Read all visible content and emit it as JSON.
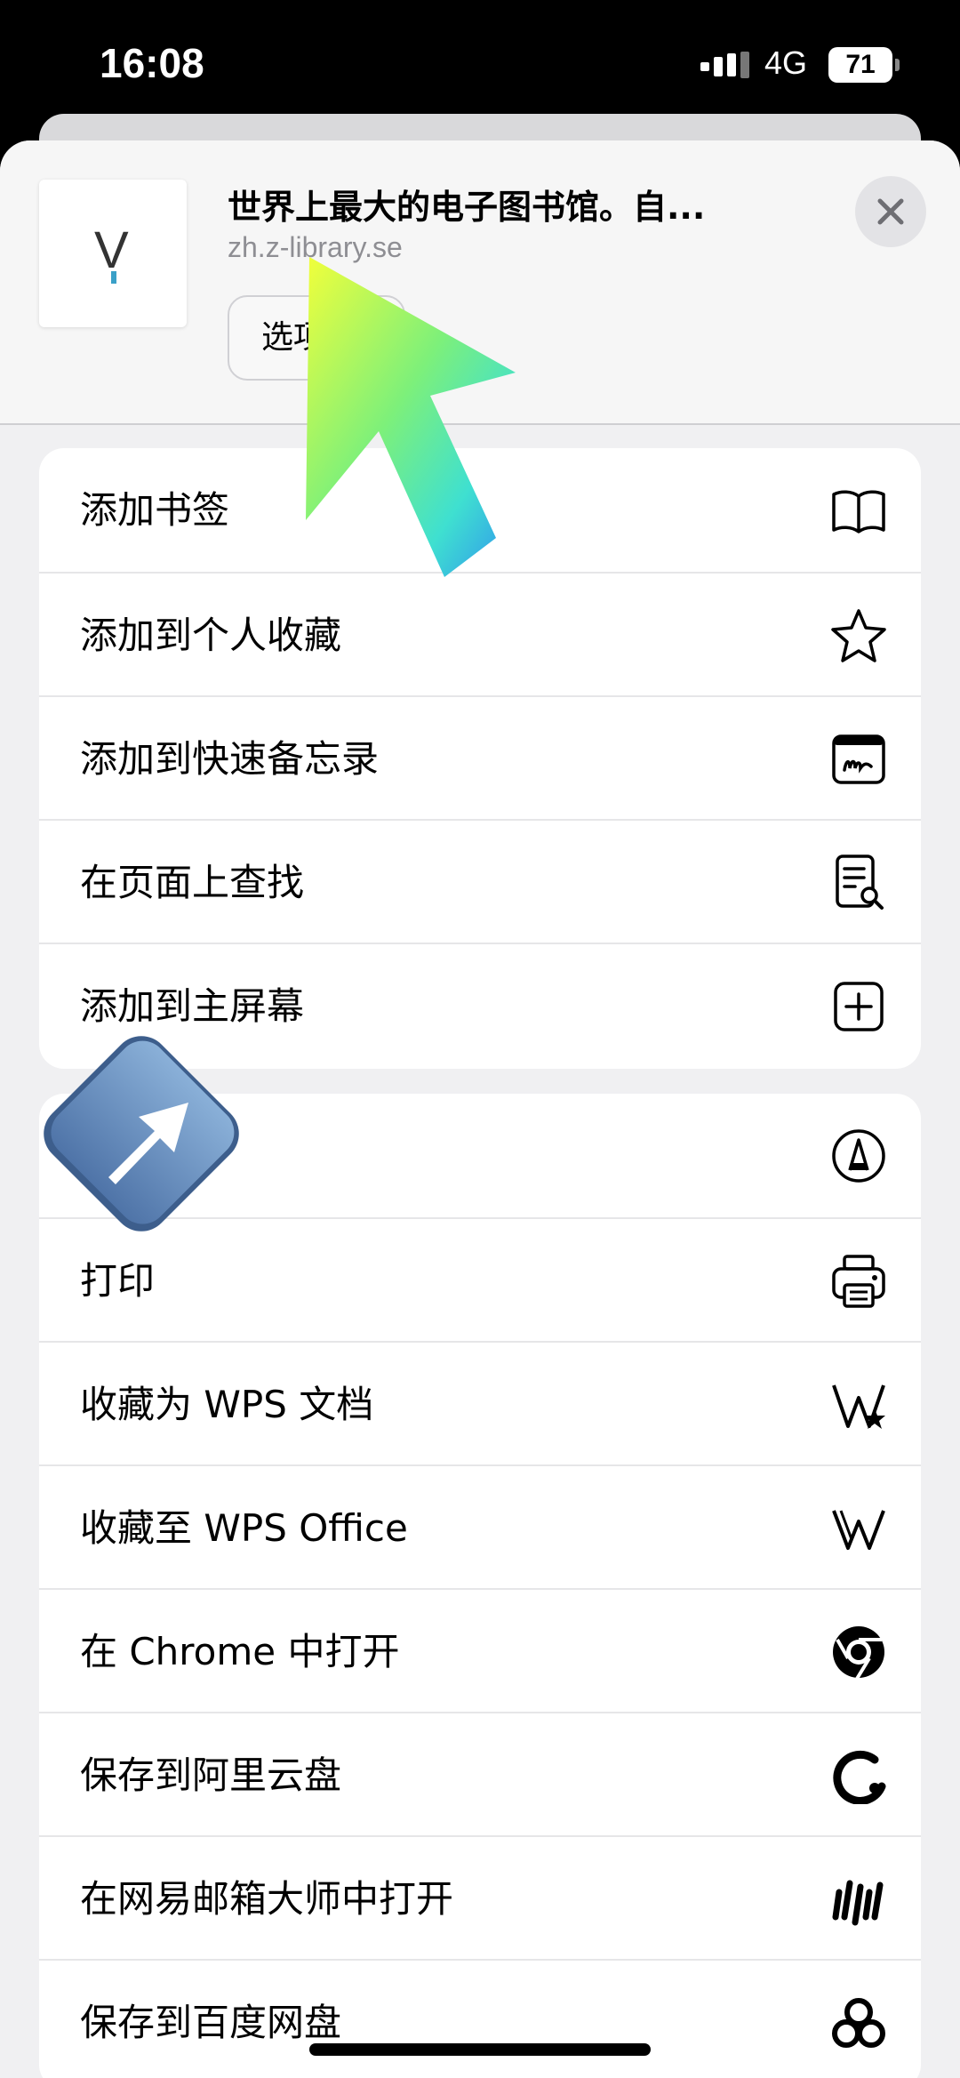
{
  "status_bar": {
    "time": "16:08",
    "network": "4G",
    "battery": "71"
  },
  "share_sheet": {
    "site_title": "世界上最大的电子图书馆。自...",
    "site_url": "zh.z-library.se",
    "thumbnail_letter": "V",
    "options_label": "选项",
    "group1": [
      {
        "label": "添加书签",
        "icon": "book-icon"
      },
      {
        "label": "添加到个人收藏",
        "icon": "star-icon"
      },
      {
        "label": "添加到快速备忘录",
        "icon": "quick-note-icon"
      },
      {
        "label": "在页面上查找",
        "icon": "find-in-page-icon"
      },
      {
        "label": "添加到主屏幕",
        "icon": "add-square-icon"
      }
    ],
    "group2": [
      {
        "label": "",
        "icon": "markup-icon"
      },
      {
        "label": "打印",
        "icon": "printer-icon"
      },
      {
        "label": "收藏为 WPS 文档",
        "icon": "wps-doc-icon"
      },
      {
        "label": "收藏至 WPS Office",
        "icon": "wps-office-icon"
      },
      {
        "label": "在 Chrome 中打开",
        "icon": "chrome-icon"
      },
      {
        "label": "保存到阿里云盘",
        "icon": "aliyun-drive-icon"
      },
      {
        "label": "在网易邮箱大师中打开",
        "icon": "netease-mail-icon"
      },
      {
        "label": "保存到百度网盘",
        "icon": "baidu-netdisk-icon"
      }
    ]
  }
}
